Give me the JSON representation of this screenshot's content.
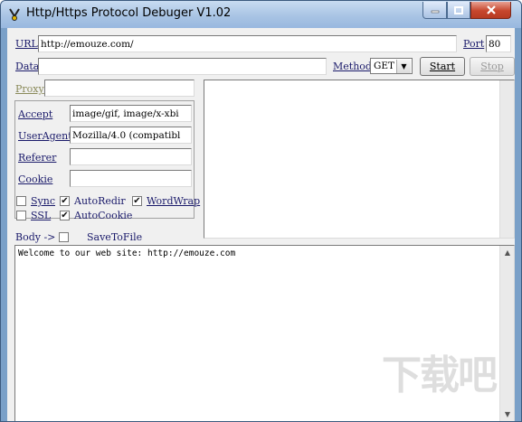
{
  "window": {
    "title": "Http/Https Protocol Debuger V1.02"
  },
  "form": {
    "url_label": "URL",
    "url_value": "http://emouze.com/",
    "port_label": "Port",
    "port_value": "80",
    "data_label": "Data",
    "data_value": "",
    "method_label": "Method",
    "method_value": "GET",
    "start_label": "Start",
    "stop_label": "Stop",
    "proxy_label": "Proxy",
    "proxy_value": ""
  },
  "headers": {
    "accept_label": "Accept",
    "accept_value": "image/gif, image/x-xbi",
    "useragent_label": "UserAgent",
    "useragent_value": "Mozilla/4.0 (compatibl",
    "referer_label": "Referer",
    "referer_value": "",
    "cookie_label": "Cookie",
    "cookie_value": ""
  },
  "options": {
    "sync": {
      "label": "Sync",
      "checked": false
    },
    "autoredir": {
      "label": "AutoRedir",
      "checked": true
    },
    "wordwrap": {
      "label": "WordWrap",
      "checked": true
    },
    "ssl": {
      "label": "SSL",
      "checked": false
    },
    "autocookie": {
      "label": "AutoCookie",
      "checked": true
    }
  },
  "body": {
    "label": "Body ->",
    "savetofile": {
      "label": "SaveToFile",
      "checked": false
    },
    "content": "Welcome to our web site: http://emouze.com"
  },
  "watermark": "下载吧",
  "icons": {
    "check": "✔",
    "dropdown": "▼",
    "up": "▲",
    "down": "▼"
  }
}
